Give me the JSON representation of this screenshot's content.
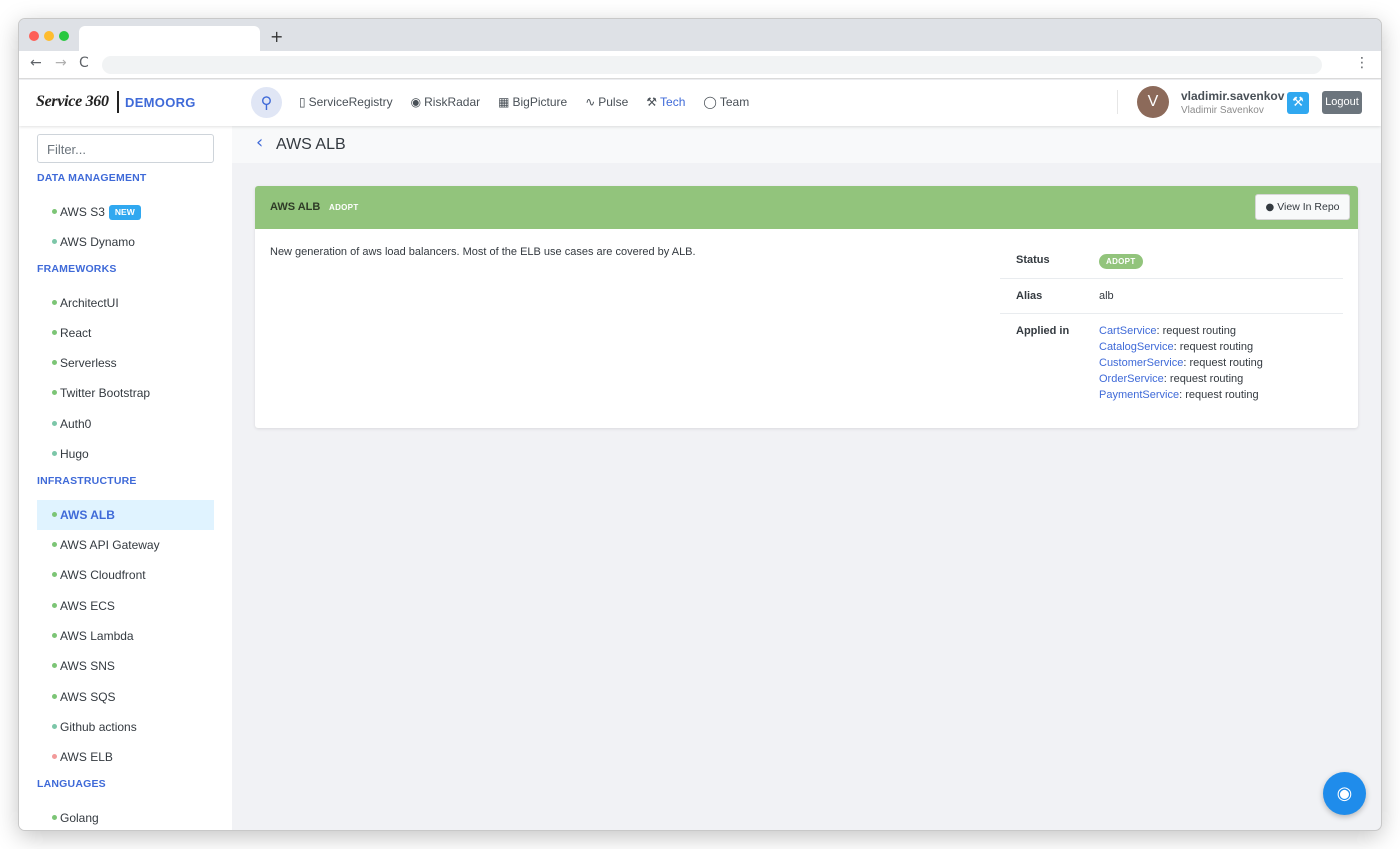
{
  "browser": {
    "new_tab_symbol": "+",
    "back_symbol": "←",
    "forward_symbol": "→",
    "reload_symbol": "C",
    "menu_symbol": "⋮"
  },
  "header": {
    "logo_text": "Service 360",
    "org_name": "DEMOORG",
    "nav": [
      {
        "label": "ServiceRegistry",
        "icon": "clipboard-icon",
        "active": false
      },
      {
        "label": "RiskRadar",
        "icon": "eye-icon",
        "active": false
      },
      {
        "label": "BigPicture",
        "icon": "map-icon",
        "active": false
      },
      {
        "label": "Pulse",
        "icon": "pulse-icon",
        "active": false
      },
      {
        "label": "Tech",
        "icon": "tools-icon",
        "active": true
      },
      {
        "label": "Team",
        "icon": "team-icon",
        "active": false
      }
    ],
    "user": {
      "avatar_initial": "V",
      "username": "vladimir.savenkov",
      "full_name": "Vladimir Savenkov"
    },
    "logout_label": "Logout"
  },
  "sidebar": {
    "filter_placeholder": "Filter...",
    "groups": [
      {
        "title": "DATA MANAGEMENT",
        "items": [
          {
            "label": "AWS S3",
            "badge": "NEW",
            "color": "#7cc576"
          },
          {
            "label": "AWS Dynamo",
            "color": "#7cc6a8"
          }
        ]
      },
      {
        "title": "FRAMEWORKS",
        "items": [
          {
            "label": "ArchitectUI",
            "color": "#7cc576"
          },
          {
            "label": "React",
            "color": "#7cc576"
          },
          {
            "label": "Serverless",
            "color": "#7cc576"
          },
          {
            "label": "Twitter Bootstrap",
            "color": "#7cc576"
          },
          {
            "label": "Auth0",
            "color": "#7cc6a8"
          },
          {
            "label": "Hugo",
            "color": "#7cc6a8"
          }
        ]
      },
      {
        "title": "INFRASTRUCTURE",
        "items": [
          {
            "label": "AWS ALB",
            "color": "#7cc576",
            "active": true
          },
          {
            "label": "AWS API Gateway",
            "color": "#7cc576"
          },
          {
            "label": "AWS Cloudfront",
            "color": "#7cc576"
          },
          {
            "label": "AWS ECS",
            "color": "#7cc576"
          },
          {
            "label": "AWS Lambda",
            "color": "#7cc576"
          },
          {
            "label": "AWS SNS",
            "color": "#7cc576"
          },
          {
            "label": "AWS SQS",
            "color": "#7cc576"
          },
          {
            "label": "Github actions",
            "color": "#7cc6a8"
          },
          {
            "label": "AWS ELB",
            "color": "#f29a9a"
          }
        ]
      },
      {
        "title": "LANGUAGES",
        "items": [
          {
            "label": "Golang",
            "color": "#7cc576"
          }
        ]
      }
    ]
  },
  "main": {
    "back_symbol": "‹",
    "page_title": "AWS ALB",
    "card": {
      "title": "AWS ALB",
      "ring": "ADOPT",
      "repo_button": "View In Repo",
      "description": "New generation of aws load balancers. Most of the ELB use cases are covered by ALB.",
      "status_label": "Status",
      "status_value": "ADOPT",
      "alias_label": "Alias",
      "alias_value": "alb",
      "applied_label": "Applied in",
      "applied_in": [
        {
          "service": "CartService",
          "usage": ": request routing"
        },
        {
          "service": "CatalogService",
          "usage": ": request routing"
        },
        {
          "service": "CustomerService",
          "usage": ": request routing"
        },
        {
          "service": "OrderService",
          "usage": ": request routing"
        },
        {
          "service": "PaymentService",
          "usage": ": request routing"
        }
      ]
    }
  },
  "colors": {
    "accent": "#3f6ad8",
    "adopt_green": "#92c47c",
    "new_badge": "#30a8f0"
  }
}
